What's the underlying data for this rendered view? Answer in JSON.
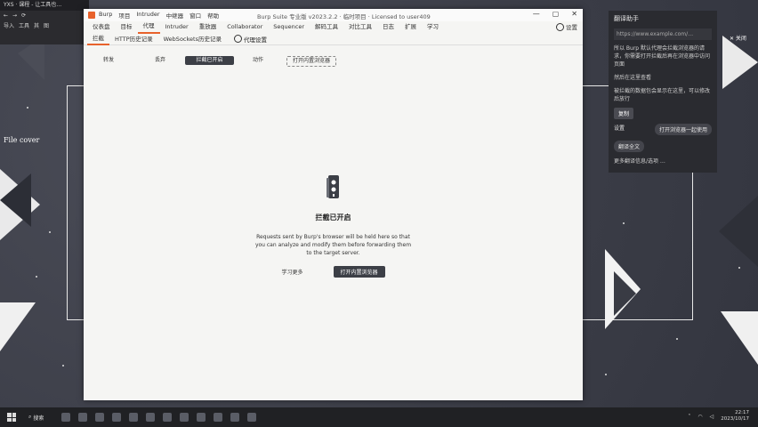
{
  "bg_browser": {
    "tab_label": "YXS · 课程 - 让工具也…",
    "nav": [
      "←",
      "→",
      "⟳"
    ],
    "bookmarks": [
      "导入",
      "工具",
      "其",
      "图"
    ]
  },
  "desktop": {
    "file_label": "File cover"
  },
  "side_panel": {
    "title": "翻译助手",
    "url": "https://www.example.com/…",
    "text1": "所以 Burp 默认代理会拦截浏览器的请求，你需要打开拦截后再在浏览器中访问页面",
    "text2": "然后在这里查看",
    "text3": "被拦截的数据包会显示在这里，可以修改后放行",
    "btn1": "复制",
    "row_left": "设置",
    "row_right": "打开浏览器一起使用",
    "pill": "翻译全文",
    "footer": "更多翻译信息/选项 …"
  },
  "corner_button": "✕ 关闭",
  "burp": {
    "menu": [
      "Burp",
      "项目",
      "Intruder",
      "中继器",
      "窗口",
      "帮助"
    ],
    "window_title": "Burp Suite 专业版  v2023.2.2 · 临时项目 · Licensed to user409",
    "window_controls": [
      "—",
      "▢",
      "✕"
    ],
    "main_tabs": [
      "仪表盘",
      "目标",
      "代理",
      "Intruder",
      "重放器",
      "Collaborator",
      "Sequencer",
      "解码工具",
      "对比工具",
      "日志",
      "扩展",
      "学习"
    ],
    "active_main_tab": 2,
    "settings_label": "设置",
    "sub_tabs": [
      "拦截",
      "HTTP历史记录",
      "WebSockets历史记录"
    ],
    "active_sub_tab": 0,
    "sub_settings_label": "代理设置",
    "toolbar": {
      "forward": "转发",
      "drop": "丢弃",
      "intercept": "拦截已开启",
      "action": "动作",
      "open_browser": "打开内置浏览器"
    },
    "intercept": {
      "heading": "拦截已开启",
      "desc": "Requests sent by Burp's browser will be held here so that you can analyze and modify them before forwarding them to the target server.",
      "learn_more": "学习更多",
      "open_browser": "打开内置浏览器"
    }
  },
  "taskbar": {
    "search": "搜索",
    "time": "22:17",
    "date": "2023/10/17"
  },
  "colors": {
    "accent": "#e8622c",
    "dark_button": "#3c3f46"
  }
}
